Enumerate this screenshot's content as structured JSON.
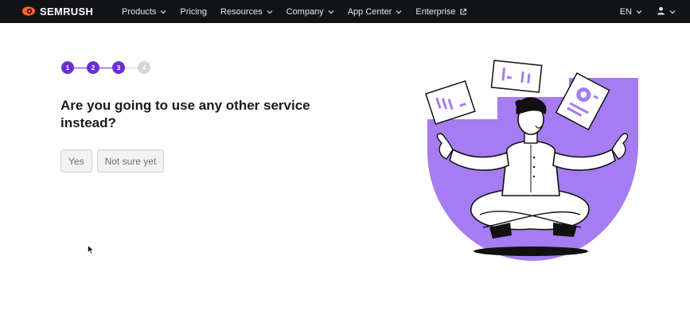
{
  "brand": {
    "name": "SEMRUSH",
    "accent": "#ff642d"
  },
  "nav": {
    "items": [
      {
        "label": "Products",
        "has_dropdown": true
      },
      {
        "label": "Pricing",
        "has_dropdown": false
      },
      {
        "label": "Resources",
        "has_dropdown": true
      },
      {
        "label": "Company",
        "has_dropdown": true
      },
      {
        "label": "App Center",
        "has_dropdown": true
      },
      {
        "label": "Enterprise",
        "external": true
      }
    ],
    "language": "EN",
    "user_icon": "user-icon"
  },
  "stepper": {
    "steps": [
      "1",
      "2",
      "3",
      "4"
    ],
    "current": 3,
    "active_color": "#6b2ed6"
  },
  "question": {
    "text": "Are you going to use any other service instead?"
  },
  "answers": [
    {
      "label": "Yes"
    },
    {
      "label": "Not sure yet"
    }
  ],
  "illustration": {
    "name": "meditating-person-with-documents",
    "accent": "#a57cf2"
  }
}
